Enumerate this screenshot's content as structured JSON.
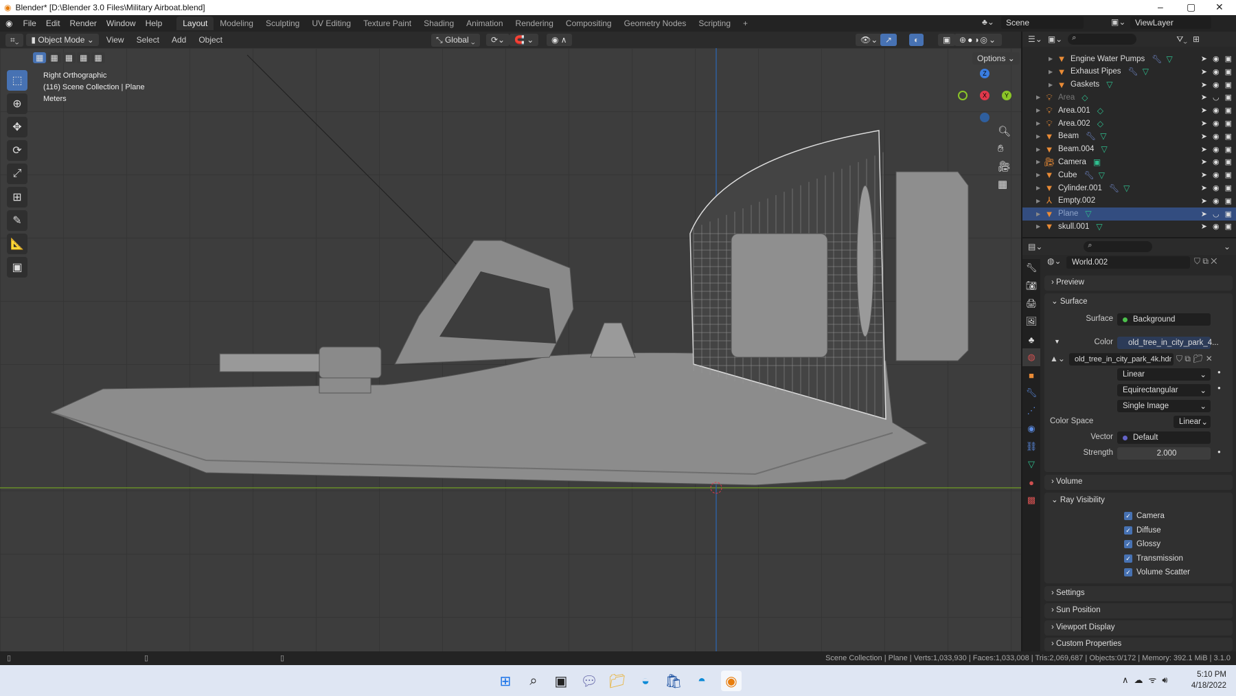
{
  "window": {
    "title": "Blender* [D:\\Blender 3.0 Files\\Military Airboat.blend]"
  },
  "menu": {
    "items": [
      "File",
      "Edit",
      "Render",
      "Window",
      "Help"
    ],
    "workspaces": [
      "Layout",
      "Modeling",
      "Sculpting",
      "UV Editing",
      "Texture Paint",
      "Shading",
      "Animation",
      "Rendering",
      "Compositing",
      "Geometry Nodes",
      "Scripting",
      "+"
    ],
    "active_workspace": "Layout",
    "scene": "Scene",
    "view_layer": "ViewLayer"
  },
  "viewport_header": {
    "mode": "Object Mode",
    "menus": [
      "View",
      "Select",
      "Add",
      "Object"
    ],
    "orientation": "Global",
    "options": "Options"
  },
  "viewport": {
    "view_name": "Right Orthographic",
    "collection": "(116) Scene Collection | Plane",
    "units": "Meters",
    "gizmo": {
      "z": "Z",
      "y": "Y",
      "x": "X"
    }
  },
  "outliner": {
    "items": [
      {
        "name": "Engine Water Pumps",
        "icon": "mesh",
        "mods": [
          "wrench",
          "mesh-data"
        ],
        "indent": 2
      },
      {
        "name": "Exhaust Pipes",
        "icon": "mesh",
        "mods": [
          "wrench",
          "mesh-data"
        ],
        "indent": 2
      },
      {
        "name": "Gaskets",
        "icon": "mesh",
        "mods": [
          "mesh-data"
        ],
        "indent": 2
      },
      {
        "name": "Area",
        "icon": "light",
        "mods": [
          "light-data"
        ],
        "indent": 1,
        "hidden": true
      },
      {
        "name": "Area.001",
        "icon": "light",
        "mods": [
          "light-data"
        ],
        "indent": 1
      },
      {
        "name": "Area.002",
        "icon": "light",
        "mods": [
          "light-data"
        ],
        "indent": 1
      },
      {
        "name": "Beam",
        "icon": "mesh",
        "mods": [
          "wrench",
          "mesh-data"
        ],
        "indent": 1
      },
      {
        "name": "Beam.004",
        "icon": "mesh",
        "mods": [
          "mesh-data"
        ],
        "indent": 1
      },
      {
        "name": "Camera",
        "icon": "camera",
        "mods": [
          "camera-data"
        ],
        "indent": 1
      },
      {
        "name": "Cube",
        "icon": "mesh",
        "mods": [
          "wrench",
          "mesh-data"
        ],
        "indent": 1
      },
      {
        "name": "Cylinder.001",
        "icon": "mesh",
        "mods": [
          "wrench",
          "mesh-data"
        ],
        "indent": 1
      },
      {
        "name": "Empty.002",
        "icon": "empty",
        "mods": [],
        "indent": 1
      },
      {
        "name": "Plane",
        "icon": "mesh",
        "mods": [
          "mesh-data"
        ],
        "indent": 1,
        "selected": true
      },
      {
        "name": "skull.001",
        "icon": "mesh",
        "mods": [
          "mesh-data"
        ],
        "indent": 1
      }
    ]
  },
  "properties": {
    "world": "World.002",
    "sections": {
      "preview": "Preview",
      "surface": "Surface",
      "volume": "Volume",
      "ray_visibility": "Ray Visibility",
      "settings": "Settings",
      "sun_position": "Sun Position",
      "viewport_display": "Viewport Display",
      "custom_properties": "Custom Properties"
    },
    "surface_label": "Surface",
    "surface_value": "Background",
    "color_label": "Color",
    "color_value": "old_tree_in_city_park_4...",
    "image": "old_tree_in_city_park_4k.hdr",
    "interpolation": "Linear",
    "projection": "Equirectangular",
    "source": "Single Image",
    "color_space_label": "Color Space",
    "color_space": "Linear",
    "vector_label": "Vector",
    "vector_value": "Default",
    "strength_label": "Strength",
    "strength_value": "2.000",
    "ray_visibility": [
      {
        "label": "Camera",
        "checked": true
      },
      {
        "label": "Diffuse",
        "checked": true
      },
      {
        "label": "Glossy",
        "checked": true
      },
      {
        "label": "Transmission",
        "checked": true
      },
      {
        "label": "Volume Scatter",
        "checked": true
      }
    ]
  },
  "statusbar": {
    "stats": "Scene Collection | Plane | Verts:1,033,930 | Faces:1,033,008 | Tris:2,069,687 | Objects:0/172 | Memory: 392.1 MiB | 3.1.0"
  },
  "taskbar": {
    "time": "5:10 PM",
    "date": "4/18/2022"
  },
  "colors": {
    "accent": "#4772b3",
    "selected_row": "#334d80",
    "object_orange": "#e98b36",
    "x_axis": "#e0384b",
    "y_axis": "#8bc628",
    "z_axis": "#3a7de0"
  }
}
